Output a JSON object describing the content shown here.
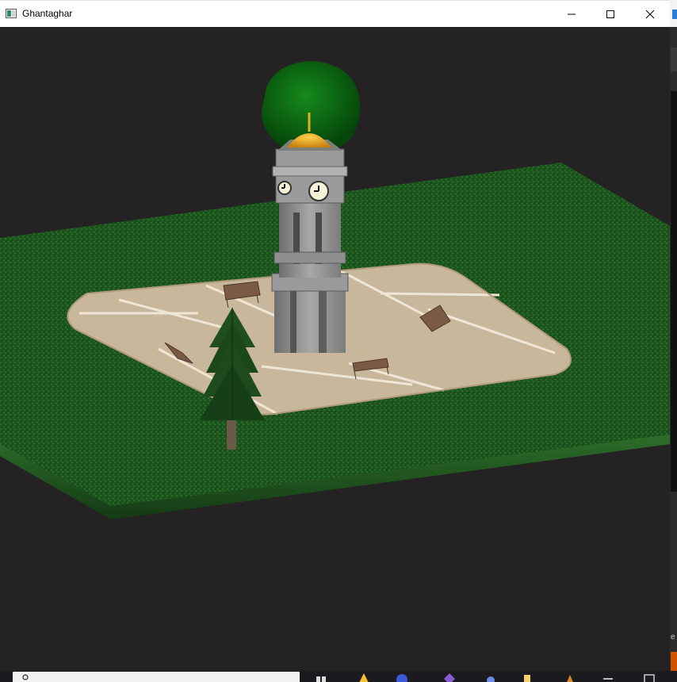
{
  "window": {
    "title": "Ghantaghar",
    "controls": [
      "minimize",
      "maximize",
      "close"
    ]
  },
  "scene": {
    "description_icon": "clock-tower-scene",
    "elements": [
      "grass-ground",
      "stone-plaza",
      "clock-tower",
      "round-tree",
      "pine-tree",
      "park-bench"
    ]
  },
  "colors": {
    "viewport_bg": "#242223",
    "grass": "#1f5a1f",
    "plaza": "#c8b59a",
    "tower": "#8c8c8c",
    "dome": "#e6a11c",
    "tree": "#0f6a14",
    "pine": "#1e4a1e",
    "bench": "#7a5a44"
  },
  "right_strip": {
    "letter": "e"
  },
  "taskbar": {
    "icons": [
      "search-icon",
      "task-view-icon",
      "folder-icon",
      "browser-icon",
      "app-icon-purple",
      "app-icon-blue",
      "file-icon",
      "app-icon-orange",
      "app-icon-gray"
    ]
  }
}
